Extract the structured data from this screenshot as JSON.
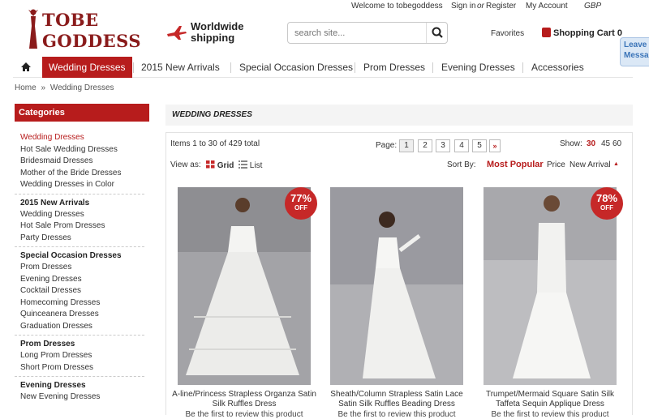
{
  "topbar": {
    "welcome": "Welcome to tobegoddess",
    "signin": "Sign in",
    "or": "or",
    "register": "Register",
    "account": "My Account",
    "currency": "GBP"
  },
  "logo": {
    "line1": "TOBE",
    "line2": "GODDESS"
  },
  "shipping": {
    "line1": "Worldwide",
    "line2": "shipping"
  },
  "search": {
    "placeholder": "search site..."
  },
  "favorites": "Favorites",
  "cart": "Shopping Cart 0",
  "leave_message": "Leave Messa",
  "nav": {
    "items": [
      "Wedding Dresses",
      "2015 New Arrivals",
      "Special Occasion Dresses",
      "Prom Dresses",
      "Evening Dresses",
      "Accessories"
    ]
  },
  "breadcrumb": {
    "home": "Home",
    "sep": "»",
    "current": "Wedding Dresses"
  },
  "sidebar": {
    "title": "Categories",
    "groups": [
      {
        "head": "Wedding Dresses",
        "links": [
          "Hot Sale Wedding Dresses",
          "Bridesmaid Dresses",
          "Mother of the Bride Dresses",
          "Wedding Dresses in Color"
        ]
      },
      {
        "head": "2015 New Arrivals",
        "links": [
          "Wedding Dresses",
          "Hot Sale Prom Dresses",
          "Party Dresses"
        ]
      },
      {
        "head": "Special Occasion Dresses",
        "links": [
          "Prom Dresses",
          "Evening Dresses",
          "Cocktail Dresses",
          "Homecoming Dresses",
          "Quinceanera Dresses",
          "Graduation Dresses"
        ]
      },
      {
        "head": "Prom Dresses",
        "links": [
          "Long Prom Dresses",
          "Short Prom Dresses"
        ]
      },
      {
        "head": "Evening Dresses",
        "links": [
          "New Evening Dresses"
        ]
      }
    ]
  },
  "main": {
    "title": "WEDDING DRESSES",
    "items_text": "Items 1 to 30 of 429 total",
    "page_label": "Page:",
    "pages": [
      "1",
      "2",
      "3",
      "4",
      "5",
      "»"
    ],
    "show_label": "Show:",
    "show_options": [
      "30",
      "45",
      "60"
    ],
    "view_label": "View as:",
    "grid_label": "Grid",
    "list_label": "List",
    "sort_label": "Sort By:",
    "sort_options": [
      "Most Popular",
      "Price",
      "New Arrival"
    ],
    "sort_arrow": "▲"
  },
  "products": [
    {
      "name": "A-line/Princess Strapless Organza Satin Silk Ruffles Dress",
      "badge": "77%",
      "off": "OFF",
      "review": "Be the first to review this product"
    },
    {
      "name": "Sheath/Column Strapless Satin Lace Satin Silk Ruffles Beading Dress",
      "badge": "",
      "off": "",
      "review": "Be the first to review this product"
    },
    {
      "name": "Trumpet/Mermaid Square Satin Silk Taffeta Sequin Applique Dress",
      "badge": "78%",
      "off": "OFF",
      "review": "Be the first to review this product"
    }
  ],
  "colors": {
    "accent": "#b71c1c",
    "badge": "#c62828"
  }
}
